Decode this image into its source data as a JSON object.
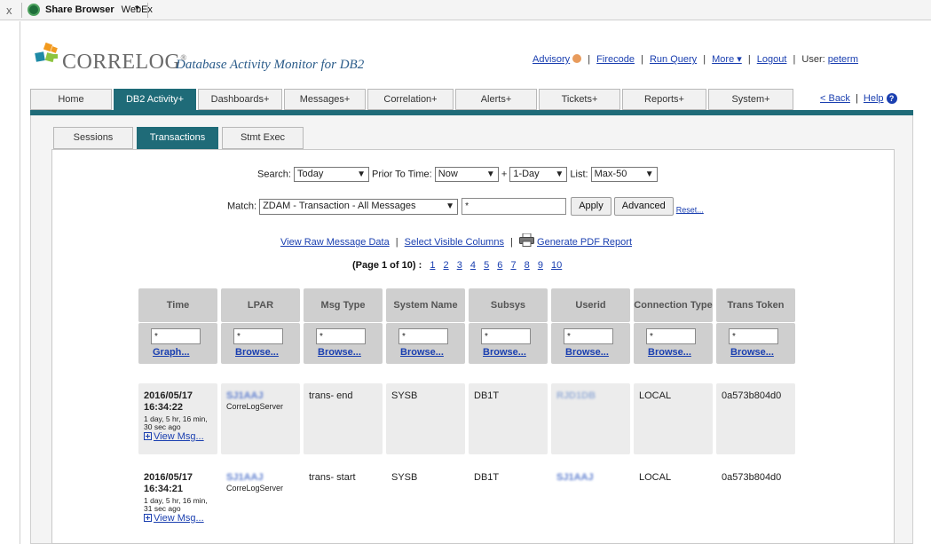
{
  "browser": {
    "close_glyph": "x",
    "app_name": "Share Browser",
    "tab_name": "WebEx",
    "menu_caret": "▾"
  },
  "brand": {
    "name": "CORRELOG",
    "trademark": "®",
    "subtitle": "Database Activity Monitor for DB2",
    "colors": {
      "orange": "#f29a1f",
      "teal": "#1f8aa6",
      "green": "#8cc43f"
    }
  },
  "header_links": {
    "advisory": "Advisory",
    "firecode": "Firecode",
    "run_query": "Run Query",
    "more": "More ▾",
    "logout": "Logout",
    "user_label": "User:",
    "user": "peterm",
    "separator": "|"
  },
  "main_tabs": [
    {
      "label": "Home",
      "active": false
    },
    {
      "label": "DB2 Activity+",
      "active": true
    },
    {
      "label": "Dashboards+",
      "active": false
    },
    {
      "label": "Messages+",
      "active": false
    },
    {
      "label": "Correlation+",
      "active": false
    },
    {
      "label": "Alerts+",
      "active": false
    },
    {
      "label": "Tickets+",
      "active": false
    },
    {
      "label": "Reports+",
      "active": false
    },
    {
      "label": "System+",
      "active": false
    }
  ],
  "nav_right": {
    "back": "< Back",
    "help": "Help",
    "help_icon": "?",
    "separator": "|"
  },
  "sub_tabs": [
    {
      "label": "Sessions",
      "active": false
    },
    {
      "label": "Transactions",
      "active": true
    },
    {
      "label": "Stmt Exec",
      "active": false
    }
  ],
  "search": {
    "search_label": "Search:",
    "search_value": "Today",
    "prior_label": "Prior To Time:",
    "prior_value": "Now",
    "plus": "+",
    "range_value": "1-Day",
    "list_label": "List:",
    "list_value": "Max-50",
    "match_label": "Match:",
    "match_value": "ZDAM - Transaction - All Messages",
    "filter_value": "*",
    "apply": "Apply",
    "advanced": "Advanced",
    "reset": "Reset..."
  },
  "action_links": {
    "raw": "View Raw Message Data",
    "columns": "Select Visible Columns",
    "pdf": "Generate PDF Report",
    "separator": "|"
  },
  "pager": {
    "label": "(Page 1 of 10) :",
    "pages": [
      "1",
      "2",
      "3",
      "4",
      "5",
      "6",
      "7",
      "8",
      "9",
      "10"
    ]
  },
  "table": {
    "headers": [
      "Time",
      "LPAR",
      "Msg Type",
      "System Name",
      "Subsys",
      "Userid",
      "Connection Type",
      "Trans Token"
    ],
    "filter_value": "*",
    "filter_links": [
      "Graph...",
      "Browse...",
      "Browse...",
      "Browse...",
      "Browse...",
      "Browse...",
      "Browse...",
      "Browse..."
    ],
    "rows": [
      {
        "date": "2016/05/17",
        "time": "16:34:22",
        "age": "1 day, 5 hr, 16 min, 30 sec ago",
        "view": "View Msg...",
        "lpar": "SJ1AAJ",
        "server": "CorreLogServer",
        "msg_type": "trans- end",
        "system": "SYSB",
        "subsys": "DB1T",
        "userid": "RJD1DB",
        "conn": "LOCAL",
        "token": "0a573b804d0"
      },
      {
        "date": "2016/05/17",
        "time": "16:34:21",
        "age": "1 day, 5 hr, 16 min, 31 sec ago",
        "view": "View Msg...",
        "lpar": "SJ1AAJ",
        "server": "CorreLogServer",
        "msg_type": "trans- start",
        "system": "SYSB",
        "subsys": "DB1T",
        "userid": "SJ1AAJ",
        "conn": "LOCAL",
        "token": "0a573b804d0"
      }
    ]
  }
}
